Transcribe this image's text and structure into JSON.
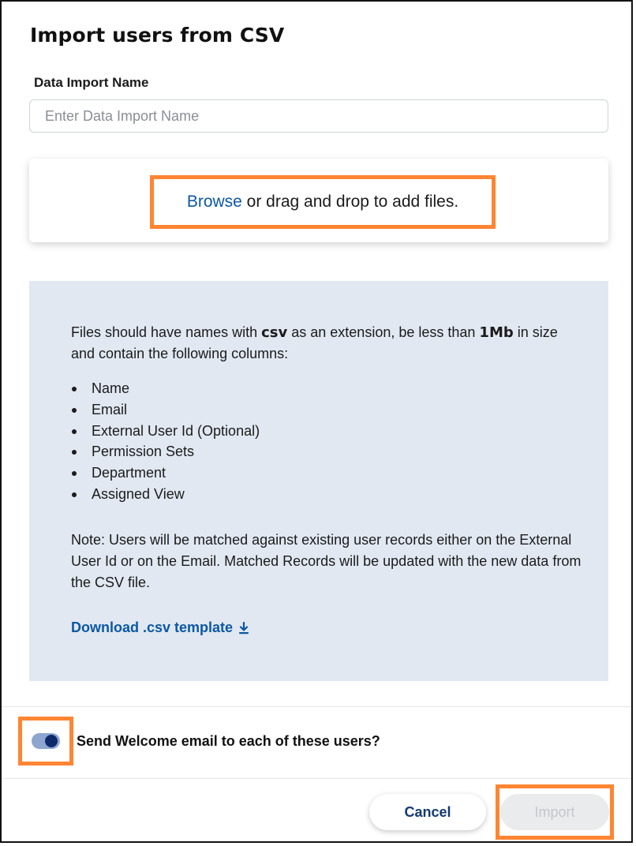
{
  "dialog": {
    "title": "Import users from CSV"
  },
  "form": {
    "name_label": "Data Import Name",
    "name_value": "",
    "name_placeholder": "Enter Data Import Name"
  },
  "upload": {
    "browse_label": "Browse",
    "drop_text": " or drag and drop to add files."
  },
  "info": {
    "intro_pre": "Files should have names with ",
    "ext_word": "csv",
    "intro_mid": " as an extension, be less than ",
    "size_limit": "1Mb",
    "intro_post": " in size and contain the following columns:",
    "columns": [
      "Name",
      "Email",
      "External User Id (Optional)",
      "Permission Sets",
      "Department",
      "Assigned View"
    ],
    "note": "Note: Users will be matched against existing user records either on the External User Id or on the Email. Matched Records will be updated with the new data from the CSV file.",
    "download_label": "Download .csv template",
    "download_icon": "download-icon"
  },
  "welcome_email": {
    "label": "Send Welcome email to each of these users?",
    "enabled": true
  },
  "footer": {
    "cancel_label": "Cancel",
    "import_label": "Import",
    "import_disabled": true
  },
  "colors": {
    "accent_link": "#0b57a4",
    "highlight": "#ff8533",
    "info_panel_bg": "#e1e8f2",
    "toggle_knob": "#0e2a6b",
    "toggle_track": "#8ea6cf"
  }
}
